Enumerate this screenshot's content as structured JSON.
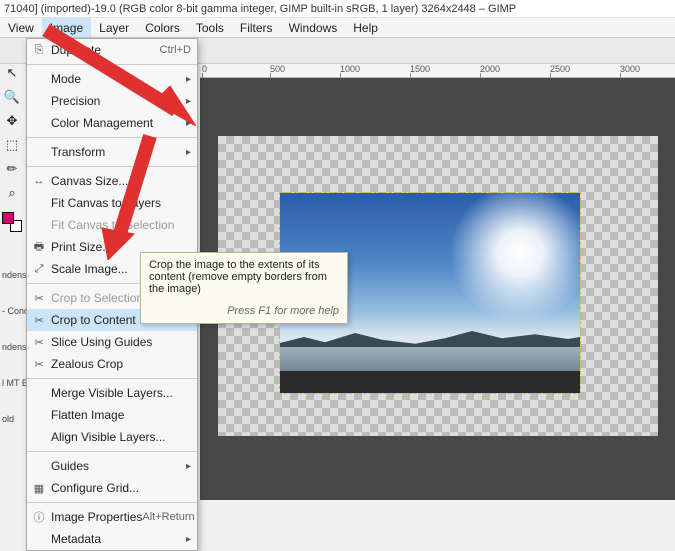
{
  "window": {
    "title": "71040] (imported)-19.0 (RGB color 8-bit gamma integer, GIMP built-in sRGB, 1 layer) 3264x2448 – GIMP"
  },
  "menubar": [
    "View",
    "Image",
    "Layer",
    "Colors",
    "Tools",
    "Filters",
    "Windows",
    "Help"
  ],
  "menubar_open_index": 1,
  "ruler_marks": [
    "0",
    "500",
    "1000",
    "1500",
    "2000",
    "2500",
    "3000"
  ],
  "dock_labels": [
    "ndensed",
    "- Cond",
    "ndensed",
    "l MT Bold,",
    "old"
  ],
  "menu": {
    "duplicate": {
      "label": "Duplicate",
      "shortcut": "Ctrl+D",
      "icon": "⎘"
    },
    "mode": {
      "label": "Mode"
    },
    "precision": {
      "label": "Precision"
    },
    "color_mgmt": {
      "label": "Color Management"
    },
    "transform": {
      "label": "Transform"
    },
    "canvas_size": {
      "label": "Canvas Size...",
      "icon": "↔"
    },
    "fit_layers": {
      "label": "Fit Canvas to Layers"
    },
    "fit_selection": {
      "label": "Fit Canvas to Selection"
    },
    "print_size": {
      "label": "Print Size...",
      "icon": "🖶"
    },
    "scale_image": {
      "label": "Scale Image...",
      "icon": "⤢"
    },
    "crop_selection": {
      "label": "Crop to Selection",
      "icon": "✂"
    },
    "crop_content": {
      "label": "Crop to Content",
      "icon": "✂"
    },
    "slice_guides": {
      "label": "Slice Using Guides",
      "icon": "✂"
    },
    "zealous_crop": {
      "label": "Zealous Crop",
      "icon": "✂"
    },
    "merge_visible": {
      "label": "Merge Visible Layers..."
    },
    "flatten": {
      "label": "Flatten Image"
    },
    "align_layers": {
      "label": "Align Visible Layers..."
    },
    "guides": {
      "label": "Guides"
    },
    "config_grid": {
      "label": "Configure Grid...",
      "icon": "▦"
    },
    "properties": {
      "label": "Image Properties",
      "shortcut": "Alt+Return",
      "icon": "ⓘ"
    },
    "metadata": {
      "label": "Metadata"
    }
  },
  "tooltip": {
    "text": "Crop the image to the extents of its content (remove empty borders from the image)",
    "hint": "Press F1 for more help"
  },
  "toolbox_icons": [
    "↖",
    "🔍",
    "✥",
    "⬚",
    "✏",
    "⌕"
  ]
}
